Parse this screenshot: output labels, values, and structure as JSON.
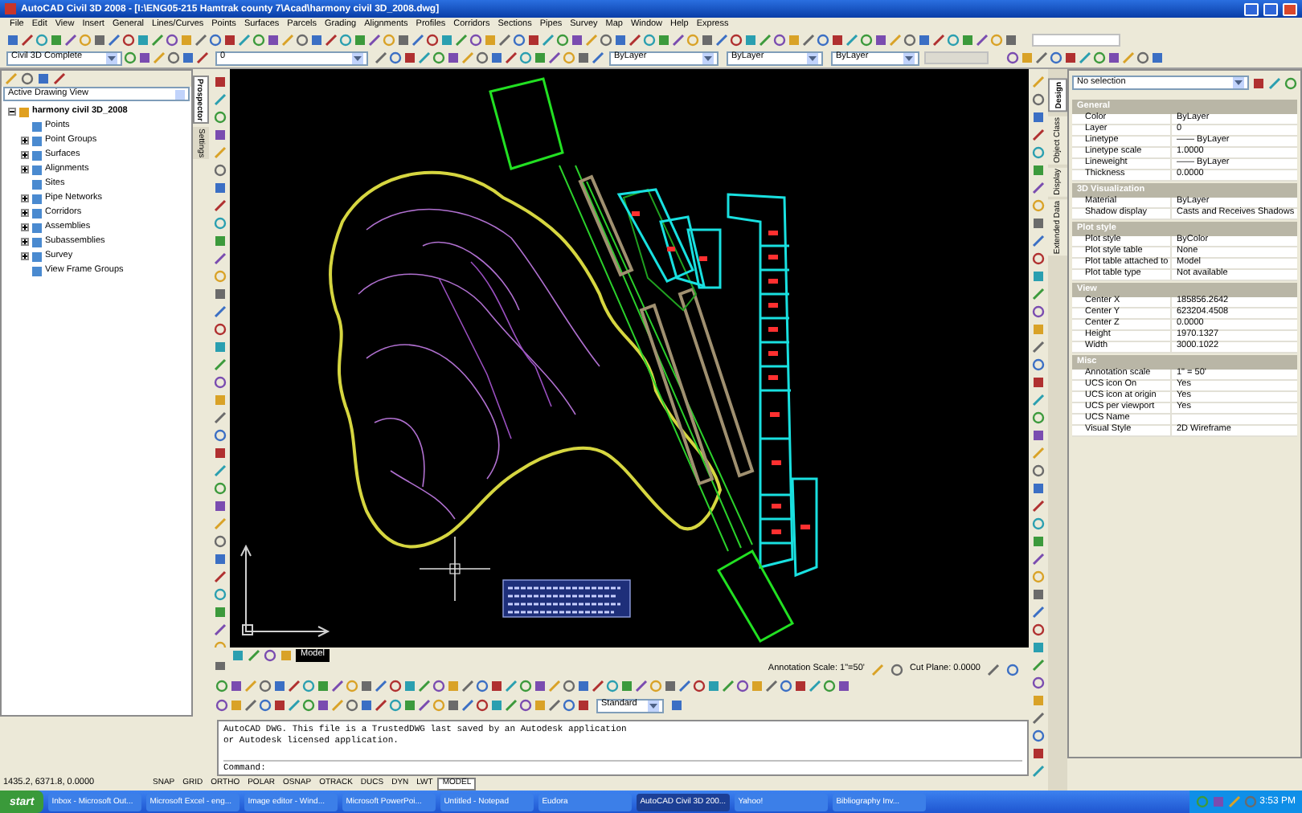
{
  "window": {
    "title": "AutoCAD Civil 3D 2008 - [I:\\ENG05-215 Hamtrak county 7\\Acad\\harmony civil 3D_2008.dwg]"
  },
  "menu": [
    "File",
    "Edit",
    "View",
    "Insert",
    "General",
    "Lines/Curves",
    "Points",
    "Surfaces",
    "Parcels",
    "Grading",
    "Alignments",
    "Profiles",
    "Corridors",
    "Sections",
    "Pipes",
    "Survey",
    "Map",
    "Window",
    "Help",
    "Express"
  ],
  "toolbar": {
    "workspace": "Civil 3D Complete",
    "layer": "0",
    "color_setting": "ByLayer",
    "linetype": "ByLayer",
    "lineweight": "ByLayer"
  },
  "toolspace": {
    "view": "Active Drawing View",
    "tabs": [
      {
        "label": "Prospector",
        "selected": true
      },
      {
        "label": "Settings",
        "selected": false
      }
    ],
    "tree": [
      {
        "label": "harmony civil 3D_2008",
        "kind": "group",
        "children": [
          {
            "label": "Points",
            "kind": "leaf"
          },
          {
            "label": "Point Groups",
            "kind": "group"
          },
          {
            "label": "Surfaces",
            "kind": "group"
          },
          {
            "label": "Alignments",
            "kind": "group"
          },
          {
            "label": "Sites",
            "kind": "leaf"
          },
          {
            "label": "Pipe Networks",
            "kind": "group"
          },
          {
            "label": "Corridors",
            "kind": "group"
          },
          {
            "label": "Assemblies",
            "kind": "group"
          },
          {
            "label": "Subassemblies",
            "kind": "group"
          },
          {
            "label": "Survey",
            "kind": "group"
          },
          {
            "label": "View Frame Groups",
            "kind": "leaf"
          }
        ]
      }
    ]
  },
  "drawing_tabs": [
    {
      "label": "Model",
      "selected": true
    }
  ],
  "annotation": {
    "scale": "Annotation Scale: 1\"=50'",
    "cut_plane": "Cut Plane: 0.0000"
  },
  "text_style": "Standard",
  "command": {
    "history": [
      "AutoCAD DWG.  This file is a TrustedDWG last saved by an Autodesk application",
      "or Autodesk licensed application."
    ],
    "prompt": "Command:"
  },
  "status": {
    "coords": "1435.2, 6371.8, 0.0000",
    "toggles": [
      {
        "label": "SNAP",
        "on": false
      },
      {
        "label": "GRID",
        "on": false
      },
      {
        "label": "ORTHO",
        "on": false
      },
      {
        "label": "POLAR",
        "on": false
      },
      {
        "label": "OSNAP",
        "on": false
      },
      {
        "label": "OTRACK",
        "on": false
      },
      {
        "label": "DUCS",
        "on": false
      },
      {
        "label": "DYN",
        "on": false
      },
      {
        "label": "LWT",
        "on": false
      },
      {
        "label": "MODEL",
        "on": true
      }
    ]
  },
  "properties": {
    "selection": "No selection",
    "tabs": [
      {
        "label": "Design",
        "selected": true
      },
      {
        "label": "Object Class",
        "selected": false
      },
      {
        "label": "Display",
        "selected": false
      },
      {
        "label": "Extended Data",
        "selected": false
      }
    ],
    "sections": [
      {
        "title": "General",
        "rows": [
          {
            "name": "Color",
            "value": "ByLayer"
          },
          {
            "name": "Layer",
            "value": "0"
          },
          {
            "name": "Linetype",
            "value": "—— ByLayer"
          },
          {
            "name": "Linetype scale",
            "value": "1.0000"
          },
          {
            "name": "Lineweight",
            "value": "—— ByLayer"
          },
          {
            "name": "Thickness",
            "value": "0.0000"
          }
        ]
      },
      {
        "title": "3D Visualization",
        "rows": [
          {
            "name": "Material",
            "value": "ByLayer"
          },
          {
            "name": "Shadow display",
            "value": "Casts and Receives Shadows"
          }
        ]
      },
      {
        "title": "Plot style",
        "rows": [
          {
            "name": "Plot style",
            "value": "ByColor"
          },
          {
            "name": "Plot style table",
            "value": "None"
          },
          {
            "name": "Plot table attached to",
            "value": "Model"
          },
          {
            "name": "Plot table type",
            "value": "Not available"
          }
        ]
      },
      {
        "title": "View",
        "rows": [
          {
            "name": "Center X",
            "value": "185856.2642"
          },
          {
            "name": "Center Y",
            "value": "623204.4508"
          },
          {
            "name": "Center Z",
            "value": "0.0000"
          },
          {
            "name": "Height",
            "value": "1970.1327"
          },
          {
            "name": "Width",
            "value": "3000.1022"
          }
        ]
      },
      {
        "title": "Misc",
        "rows": [
          {
            "name": "Annotation scale",
            "value": "1\" = 50'"
          },
          {
            "name": "UCS icon On",
            "value": "Yes"
          },
          {
            "name": "UCS icon at origin",
            "value": "Yes"
          },
          {
            "name": "UCS per viewport",
            "value": "Yes"
          },
          {
            "name": "UCS Name"
          },
          {
            "name": "Visual Style",
            "value": "2D Wireframe"
          }
        ]
      }
    ]
  },
  "taskbar": {
    "start": "start",
    "clock": "3:53 PM",
    "items": [
      {
        "label": "Inbox - Microsoft Out...",
        "selected": false
      },
      {
        "label": "Microsoft Excel - eng...",
        "selected": false
      },
      {
        "label": "Image editor - Wind...",
        "selected": false
      },
      {
        "label": "Microsoft PowerPoi...",
        "selected": false
      },
      {
        "label": "Untitled - Notepad",
        "selected": false
      },
      {
        "label": "Eudora",
        "selected": false
      },
      {
        "label": "AutoCAD Civil 3D 200...",
        "selected": true
      },
      {
        "label": "Yahoo!",
        "selected": false
      },
      {
        "label": "Bibliography Inv...",
        "selected": false
      }
    ]
  }
}
